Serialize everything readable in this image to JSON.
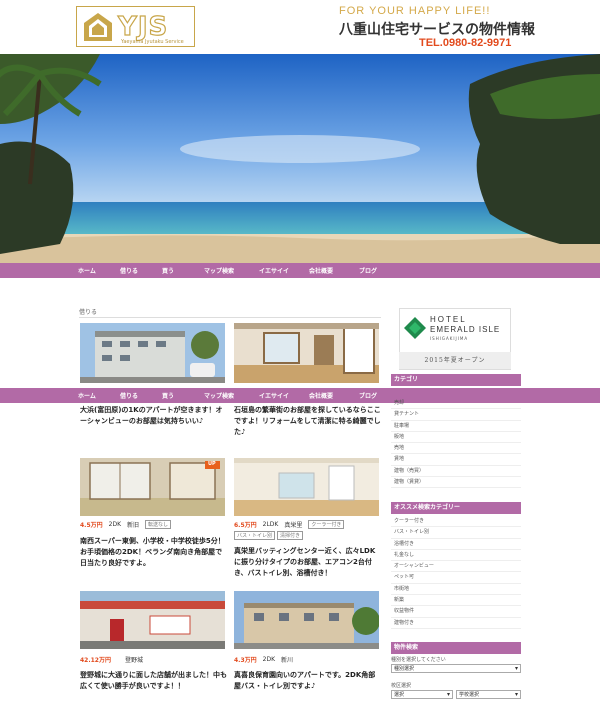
{
  "header": {
    "logo_text": "YJS",
    "logo_sub": "Yaeyama Jyutaku Service",
    "tagline": "FOR YOUR HAPPY LIFE!!",
    "site_title": "八重山住宅サービスの物件情報",
    "tel": "TEL.0980-82-9971"
  },
  "nav": {
    "items": [
      "ホーム",
      "借りる",
      "買う",
      "マップ検索",
      "イエサイイ",
      "会社概要",
      "ブログ"
    ]
  },
  "breadcrumb": "借りる",
  "listings": [
    {
      "desc": "大浜(富田原)の1Kのアパートが空きます！オーシャンビューのお部屋は気持ちいい♪"
    },
    {
      "desc": "石垣島の繁華街のお部屋を探しているならここですよ！リフォームをして清潔に特る綺麗でした♪"
    },
    {
      "price": "4.5万円",
      "layout": "2DK",
      "status": "新旧",
      "tags": [
        "転送なし"
      ],
      "new_badge": "UP",
      "desc": "南西スーパー東側、小学校・中学校徒歩5分！お手頃価格の2DK！ベランダ南向き角部屋で日当たり良好ですよ。"
    },
    {
      "price": "6.5万円",
      "layout": "2LDK",
      "status": "真栄里",
      "tags": [
        "クーラー付き",
        "バス・トイレ別",
        "清掃付き"
      ],
      "desc": "真栄里バッティングセンター近く、広々LDKに振り分けタイプのお部屋、エアコン2台付き、バストイレ別、浴槽付き！"
    },
    {
      "price": "42.12万円",
      "layout": "",
      "status": "登野城",
      "tags": [],
      "desc": "登野城に大通りに面した店舗が出ました！中も広くて使い勝手が良いですよ！！"
    },
    {
      "price": "4.3万円",
      "layout": "2DK",
      "status": "新川",
      "tags": [],
      "desc": "真喜良保育園向いのアパートです。2DK角部屋バス・トイレ別ですよ♪"
    }
  ],
  "sidebar": {
    "ad_title_1": "HOTEL",
    "ad_title_2": "EMERALD ISLE",
    "ad_sub": "ISHIGAKIJIMA",
    "ad_caption": "2015年夏オープン",
    "category_head": "カテゴリ",
    "categories": [
      "売却",
      "貸テナント",
      "駐車場",
      "販地",
      "売地",
      "賃地",
      "建物（売買）",
      "建物（賃貸）"
    ],
    "feature_head": "オススメ検索カテゴリー",
    "features": [
      "クーラー付き",
      "バス・トイレ別",
      "浴槽付き",
      "礼金なし",
      "オーシャンビュー",
      "ペット可",
      "市街地",
      "新築",
      "収益物件",
      "建物付き"
    ],
    "search_head": "物件検索",
    "search_label": "種別を選択してください",
    "search_select": "種別選択",
    "school_label": "校区選択",
    "school_select_1": "選択",
    "school_select_2": "学校選択"
  },
  "colors": {
    "accent": "#b26aa6",
    "price": "#e24a1d",
    "gold": "#c8a64a"
  }
}
